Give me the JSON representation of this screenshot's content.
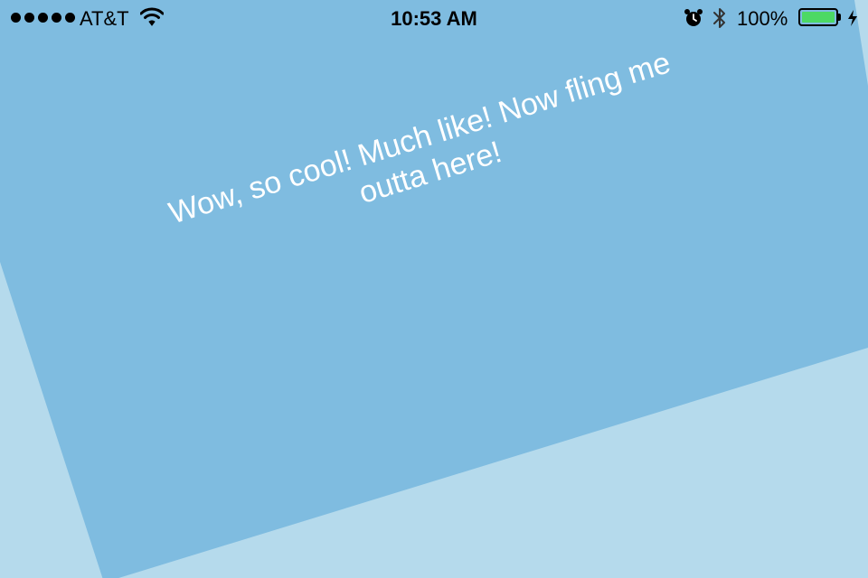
{
  "status_bar": {
    "signal_bars": 5,
    "carrier": "AT&T",
    "wifi_icon": "wifi-icon",
    "time": "10:53 AM",
    "alarm_icon": "alarm-clock-icon",
    "bluetooth_icon": "bluetooth-icon",
    "battery_percent_label": "100%",
    "battery_level": 1.0,
    "charging_icon": "lightning-bolt-icon"
  },
  "card": {
    "message": "Wow, so cool! Much like! Now fling me outta here!",
    "color": "#7fbce0"
  },
  "colors": {
    "background": "#b5daec",
    "card": "#7fbce0",
    "battery_fill": "#4cd964",
    "text": "#ffffff"
  }
}
